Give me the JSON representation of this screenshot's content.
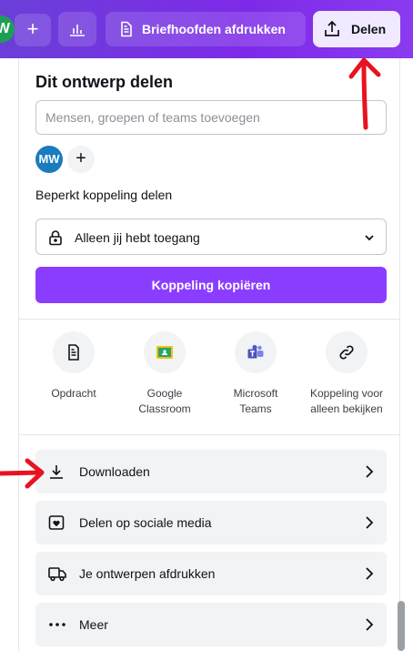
{
  "topbar": {
    "avatar_initial": "W",
    "add_label": "+",
    "print_label": "Briefhoofden afdrukken",
    "share_label": "Delen"
  },
  "panel": {
    "title": "Dit ontwerp delen",
    "people_input": {
      "value": "",
      "placeholder": "Mensen, groepen of teams toevoegen"
    },
    "avatar_initials": "MW",
    "add_person": "+",
    "section_label": "Beperkt koppeling delen",
    "access_select": "Alleen jij hebt toegang",
    "copy_link": "Koppeling kopiëren",
    "share_options": [
      {
        "label_line1": "Opdracht",
        "label_line2": "",
        "icon": "assignment-icon"
      },
      {
        "label_line1": "Google",
        "label_line2": "Classroom",
        "icon": "google-classroom-icon"
      },
      {
        "label_line1": "Microsoft",
        "label_line2": "Teams",
        "icon": "microsoft-teams-icon"
      },
      {
        "label_line1": "Koppeling voor",
        "label_line2": "alleen bekijken",
        "icon": "link-icon"
      }
    ],
    "actions": [
      {
        "label": "Downloaden",
        "icon": "download-icon"
      },
      {
        "label": "Delen op sociale media",
        "icon": "heart-social-icon"
      },
      {
        "label": "Je ontwerpen afdrukken",
        "icon": "delivery-truck-icon"
      },
      {
        "label": "Meer",
        "icon": "more-dots-icon"
      }
    ]
  },
  "colors": {
    "topbar": "#7d2ae8",
    "primary_button": "#8b3dff",
    "annotation": "#e8131f"
  }
}
